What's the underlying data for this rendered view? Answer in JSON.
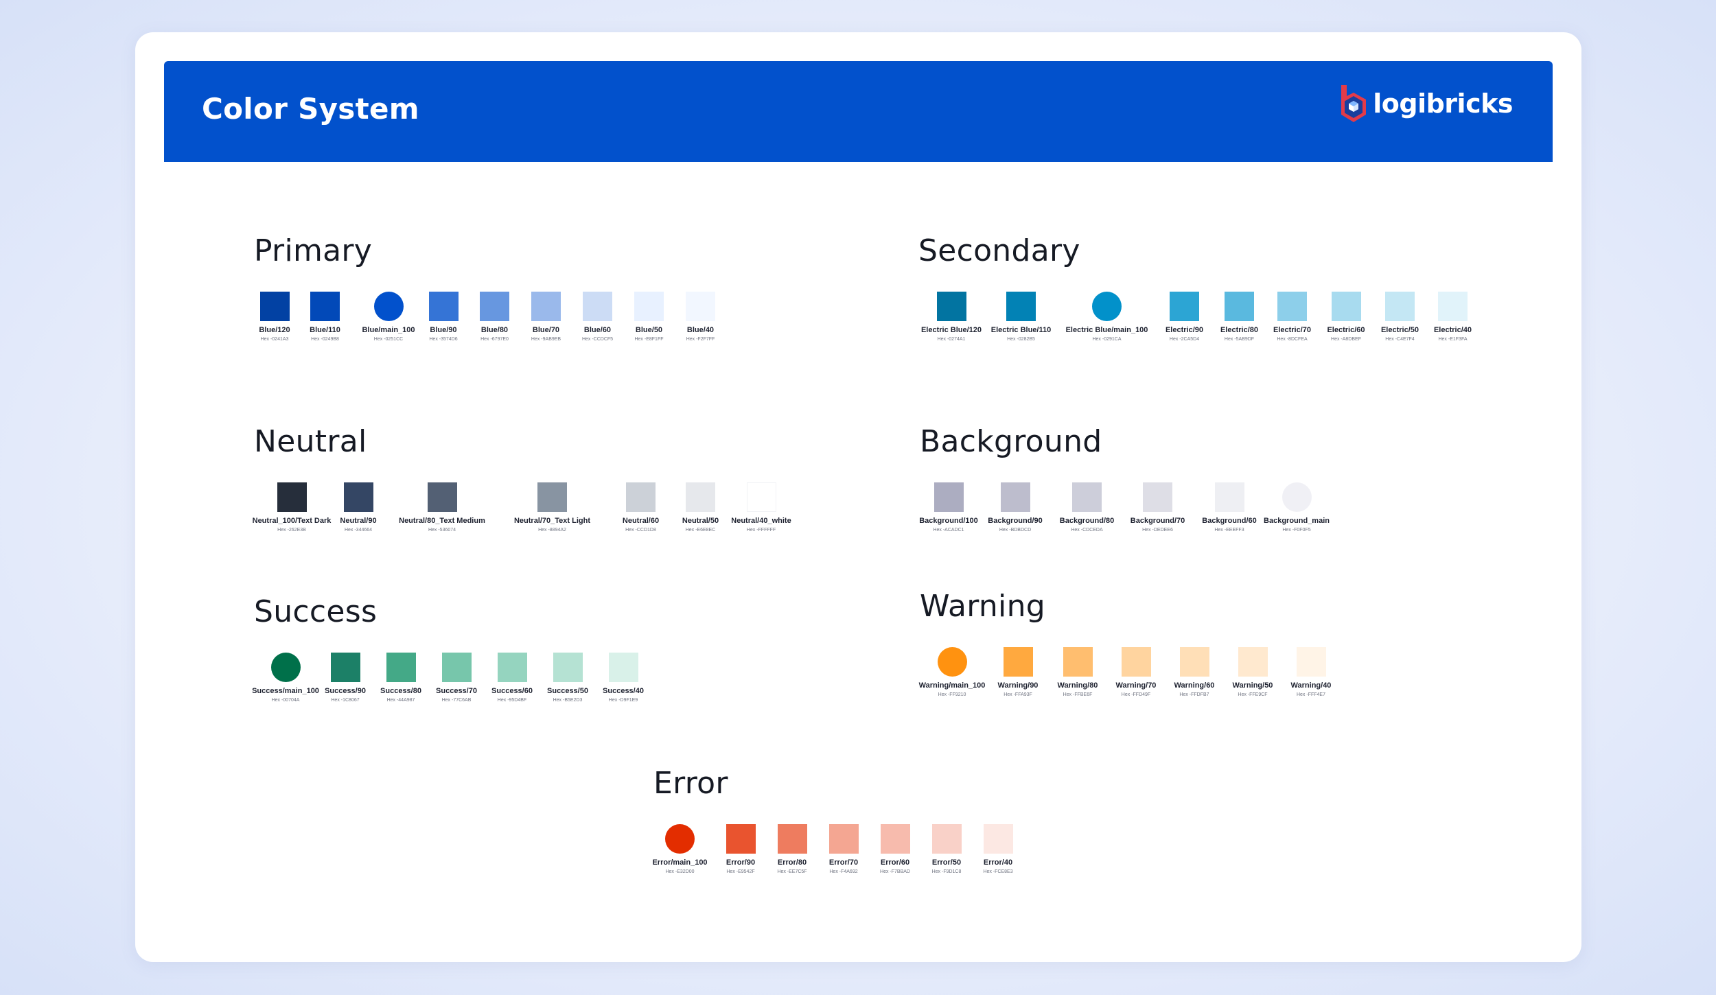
{
  "page": {
    "title": "Color System",
    "brand": "logibricks",
    "header_color": "#0251CC"
  },
  "sections": {
    "primary": {
      "title": "Primary",
      "swatches": [
        {
          "name": "Blue/120",
          "hex_label": "Hex -0241A3",
          "color": "#0241A3",
          "shape": "square"
        },
        {
          "name": "Blue/110",
          "hex_label": "Hex -0249B8",
          "color": "#0249B8",
          "shape": "square"
        },
        {
          "name": "Blue/main_100",
          "hex_label": "Hex -0251CC",
          "color": "#0251CC",
          "shape": "circle"
        },
        {
          "name": "Blue/90",
          "hex_label": "Hex -3574D6",
          "color": "#3574D6",
          "shape": "square"
        },
        {
          "name": "Blue/80",
          "hex_label": "Hex -6797E0",
          "color": "#6797E0",
          "shape": "square"
        },
        {
          "name": "Blue/70",
          "hex_label": "Hex -9AB9EB",
          "color": "#9AB9EB",
          "shape": "square"
        },
        {
          "name": "Blue/60",
          "hex_label": "Hex -CCDCF5",
          "color": "#CCDCF5",
          "shape": "square"
        },
        {
          "name": "Blue/50",
          "hex_label": "Hex -E8F1FF",
          "color": "#E8F1FF",
          "shape": "square"
        },
        {
          "name": "Blue/40",
          "hex_label": "Hex -F2F7FF",
          "color": "#F2F7FF",
          "shape": "square"
        }
      ]
    },
    "secondary": {
      "title": "Secondary",
      "swatches": [
        {
          "name": "Electric Blue/120",
          "hex_label": "Hex -0274A1",
          "color": "#0274A1",
          "shape": "square"
        },
        {
          "name": "Electric Blue/110",
          "hex_label": "Hex -0282B5",
          "color": "#0282B5",
          "shape": "square"
        },
        {
          "name": "Electric Blue/main_100",
          "hex_label": "Hex -0291CA",
          "color": "#0291CA",
          "shape": "circle"
        },
        {
          "name": "Electric/90",
          "hex_label": "Hex -2CA5D4",
          "color": "#2CA5D4",
          "shape": "square"
        },
        {
          "name": "Electric/80",
          "hex_label": "Hex -5AB9DF",
          "color": "#5AB9DF",
          "shape": "square"
        },
        {
          "name": "Electric/70",
          "hex_label": "Hex -8DCFEA",
          "color": "#8DCFEA",
          "shape": "square"
        },
        {
          "name": "Electric/60",
          "hex_label": "Hex -A8DBEF",
          "color": "#A8DBEF",
          "shape": "square"
        },
        {
          "name": "Electric/50",
          "hex_label": "Hex -C4E7F4",
          "color": "#C4E7F4",
          "shape": "square"
        },
        {
          "name": "Electric/40",
          "hex_label": "Hex -E1F3FA",
          "color": "#E1F3FA",
          "shape": "square"
        }
      ]
    },
    "neutral": {
      "title": "Neutral",
      "swatches": [
        {
          "name": "Neutral_100/Text Dark",
          "hex_label": "Hex -262E3B",
          "color": "#262E3B",
          "shape": "square"
        },
        {
          "name": "Neutral/90",
          "hex_label": "Hex -344664",
          "color": "#344664",
          "shape": "square"
        },
        {
          "name": "Neutral/80_Text Medium",
          "hex_label": "Hex -536074",
          "color": "#536074",
          "shape": "square"
        },
        {
          "name": "Neutral/70_Text Light",
          "hex_label": "Hex -8894A2",
          "color": "#8894A2",
          "shape": "square"
        },
        {
          "name": "Neutral/60",
          "hex_label": "Hex -CCD1D8",
          "color": "#CCD1D8",
          "shape": "square"
        },
        {
          "name": "Neutral/50",
          "hex_label": "Hex -E6E8EC",
          "color": "#E6E8EC",
          "shape": "square"
        },
        {
          "name": "Neutral/40_white",
          "hex_label": "Hex -FFFFFF",
          "color": "#FFFFFF",
          "shape": "square"
        }
      ]
    },
    "background": {
      "title": "Background",
      "swatches": [
        {
          "name": "Background/100",
          "hex_label": "Hex -ACADC1",
          "color": "#ACADC1",
          "shape": "square"
        },
        {
          "name": "Background/90",
          "hex_label": "Hex -BDBDCD",
          "color": "#BDBDCD",
          "shape": "square"
        },
        {
          "name": "Background/80",
          "hex_label": "Hex -CDCEDA",
          "color": "#CDCEDA",
          "shape": "square"
        },
        {
          "name": "Background/70",
          "hex_label": "Hex -DEDEE6",
          "color": "#DEDEE6",
          "shape": "square"
        },
        {
          "name": "Background/60",
          "hex_label": "Hex -EEEFF3",
          "color": "#EEEFF3",
          "shape": "square"
        },
        {
          "name": "Background_main",
          "hex_label": "Hex -F0F0F5",
          "color": "#F0F0F5",
          "shape": "circle"
        }
      ]
    },
    "success": {
      "title": "Success",
      "swatches": [
        {
          "name": "Success/main_100",
          "hex_label": "Hex -00704A",
          "color": "#00704A",
          "shape": "circle"
        },
        {
          "name": "Success/90",
          "hex_label": "Hex -1C8067",
          "color": "#1C8067",
          "shape": "square"
        },
        {
          "name": "Success/80",
          "hex_label": "Hex -44A987",
          "color": "#44A987",
          "shape": "square"
        },
        {
          "name": "Success/70",
          "hex_label": "Hex -77C6AB",
          "color": "#77C6AB",
          "shape": "square"
        },
        {
          "name": "Success/60",
          "hex_label": "Hex -95D4BF",
          "color": "#95D4BF",
          "shape": "square"
        },
        {
          "name": "Success/50",
          "hex_label": "Hex -B5E2D3",
          "color": "#B5E2D3",
          "shape": "square"
        },
        {
          "name": "Success/40",
          "hex_label": "Hex -D9F1E9",
          "color": "#D9F1E9",
          "shape": "square"
        }
      ]
    },
    "warning": {
      "title": "Warning",
      "swatches": [
        {
          "name": "Warning/main_100",
          "hex_label": "Hex -FF9210",
          "color": "#FF9210",
          "shape": "circle"
        },
        {
          "name": "Warning/90",
          "hex_label": "Hex -FFA93F",
          "color": "#FFA93F",
          "shape": "square"
        },
        {
          "name": "Warning/80",
          "hex_label": "Hex -FFBE6F",
          "color": "#FFBE6F",
          "shape": "square"
        },
        {
          "name": "Warning/70",
          "hex_label": "Hex -FFD49F",
          "color": "#FFD49F",
          "shape": "square"
        },
        {
          "name": "Warning/60",
          "hex_label": "Hex -FFDFB7",
          "color": "#FFDFB7",
          "shape": "square"
        },
        {
          "name": "Warning/50",
          "hex_label": "Hex -FFE9CF",
          "color": "#FFE9CF",
          "shape": "square"
        },
        {
          "name": "Warning/40",
          "hex_label": "Hex -FFF4E7",
          "color": "#FFF4E7",
          "shape": "square"
        }
      ]
    },
    "error": {
      "title": "Error",
      "swatches": [
        {
          "name": "Error/main_100",
          "hex_label": "Hex -E32D00",
          "color": "#E32D00",
          "shape": "circle"
        },
        {
          "name": "Error/90",
          "hex_label": "Hex -E9542F",
          "color": "#E9542F",
          "shape": "square"
        },
        {
          "name": "Error/80",
          "hex_label": "Hex -EE7C5F",
          "color": "#EE7C5F",
          "shape": "square"
        },
        {
          "name": "Error/70",
          "hex_label": "Hex -F4A692",
          "color": "#F4A692",
          "shape": "square"
        },
        {
          "name": "Error/60",
          "hex_label": "Hex -F7BBAD",
          "color": "#F7BBAD",
          "shape": "square"
        },
        {
          "name": "Error/50",
          "hex_label": "Hex -F9D1C8",
          "color": "#F9D1C8",
          "shape": "square"
        },
        {
          "name": "Error/40",
          "hex_label": "Hex -FCE8E3",
          "color": "#FCE8E3",
          "shape": "square"
        }
      ]
    }
  }
}
